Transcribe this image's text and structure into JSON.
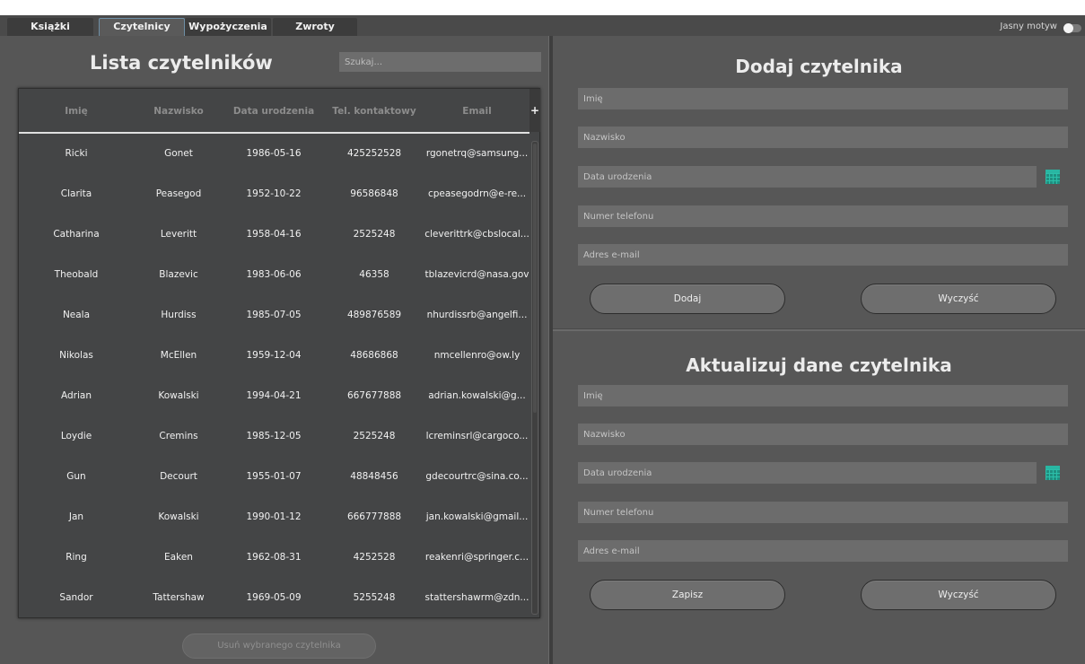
{
  "tabs": [
    {
      "label": "Książki"
    },
    {
      "label": "Czytelnicy",
      "active": true
    },
    {
      "label": "Wypożyczenia"
    },
    {
      "label": "Zwroty"
    }
  ],
  "theme": {
    "label": "Jasny motyw",
    "enabled": false
  },
  "list": {
    "title": "Lista czytelników",
    "search_placeholder": "Szukaj...",
    "columns": [
      "Imię",
      "Nazwisko",
      "Data urodzenia",
      "Tel. kontaktowy",
      "Email"
    ],
    "add_column_symbol": "+",
    "rows": [
      [
        "Ricki",
        "Gonet",
        "1986-05-16",
        "425252528",
        "rgonetrq@samsung..."
      ],
      [
        "Clarita",
        "Peasegod",
        "1952-10-22",
        "96586848",
        "cpeasegodrn@e-re..."
      ],
      [
        "Catharina",
        "Leveritt",
        "1958-04-16",
        "2525248",
        "cleverittrk@cbslocal..."
      ],
      [
        "Theobald",
        "Blazevic",
        "1983-06-06",
        "46358",
        "tblazevicrd@nasa.gov"
      ],
      [
        "Neala",
        "Hurdiss",
        "1985-07-05",
        "489876589",
        "nhurdissrb@angelfi..."
      ],
      [
        "Nikolas",
        "McEllen",
        "1959-12-04",
        "48686868",
        "nmcellenro@ow.ly"
      ],
      [
        "Adrian",
        "Kowalski",
        "1994-04-21",
        "667677888",
        "adrian.kowalski@g..."
      ],
      [
        "Loydie",
        "Cremins",
        "1985-12-05",
        "2525248",
        "lcreminsrl@cargoco..."
      ],
      [
        "Gun",
        "Decourt",
        "1955-01-07",
        "48848456",
        "gdecourtrc@sina.co..."
      ],
      [
        "Jan",
        "Kowalski",
        "1990-01-12",
        "666777888",
        "jan.kowalski@gmail..."
      ],
      [
        "Ring",
        "Eaken",
        "1962-08-31",
        "4252528",
        "reakenri@springer.c..."
      ],
      [
        "Sandor",
        "Tattershaw",
        "1969-05-09",
        "5255248",
        "stattershawrm@zdn..."
      ]
    ],
    "delete_label": "Usuń wybranego czytelnika"
  },
  "add_form": {
    "title": "Dodaj czytelnika",
    "first_name_placeholder": "Imię",
    "last_name_placeholder": "Nazwisko",
    "birth_date_placeholder": "Data urodzenia",
    "phone_placeholder": "Numer telefonu",
    "email_placeholder": "Adres e-mail",
    "submit_label": "Dodaj",
    "clear_label": "Wyczyść"
  },
  "update_form": {
    "title": "Aktualizuj dane czytelnika",
    "first_name_placeholder": "Imię",
    "last_name_placeholder": "Nazwisko",
    "birth_date_placeholder": "Data urodzenia",
    "phone_placeholder": "Numer telefonu",
    "email_placeholder": "Adres e-mail",
    "submit_label": "Zapisz",
    "clear_label": "Wyczyść"
  },
  "colors": {
    "background": "#575757",
    "table_background": "#444546",
    "field_background": "#6c6c6c",
    "calendar_accent": "#29b6a2",
    "tab_active_border": "#6e8fa6"
  }
}
